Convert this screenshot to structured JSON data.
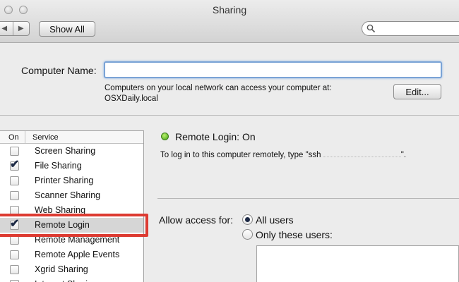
{
  "window": {
    "title": "Sharing"
  },
  "toolbar": {
    "back_glyph": "◀",
    "forward_glyph": "▶",
    "show_all_label": "Show All",
    "search_value": ""
  },
  "computer_name": {
    "label": "Computer Name:",
    "value": "",
    "info_line1": "Computers on your local network can access your computer at:",
    "info_line2": "OSXDaily.local",
    "edit_label": "Edit..."
  },
  "services": {
    "header_on": "On",
    "header_service": "Service",
    "items": [
      {
        "label": "Screen Sharing",
        "checked": false
      },
      {
        "label": "File Sharing",
        "checked": true
      },
      {
        "label": "Printer Sharing",
        "checked": false
      },
      {
        "label": "Scanner Sharing",
        "checked": false
      },
      {
        "label": "Web Sharing",
        "checked": false
      },
      {
        "label": "Remote Login",
        "checked": true,
        "selected": true
      },
      {
        "label": "Remote Management",
        "checked": false
      },
      {
        "label": "Remote Apple Events",
        "checked": false
      },
      {
        "label": "Xgrid Sharing",
        "checked": false
      },
      {
        "label": "Internet Sharing",
        "checked": false
      }
    ]
  },
  "detail": {
    "status": "Remote Login: On",
    "status_color": "#45a517",
    "instruction_prefix": "To log in to this computer remotely, type \"ssh",
    "instruction_suffix": "\".",
    "allow_label": "Allow access for:",
    "option_all": "All users",
    "option_only": "Only these users:",
    "selected_option": "all"
  },
  "colors": {
    "highlight": "#dd3b32",
    "focus": "#7aa3d6"
  }
}
